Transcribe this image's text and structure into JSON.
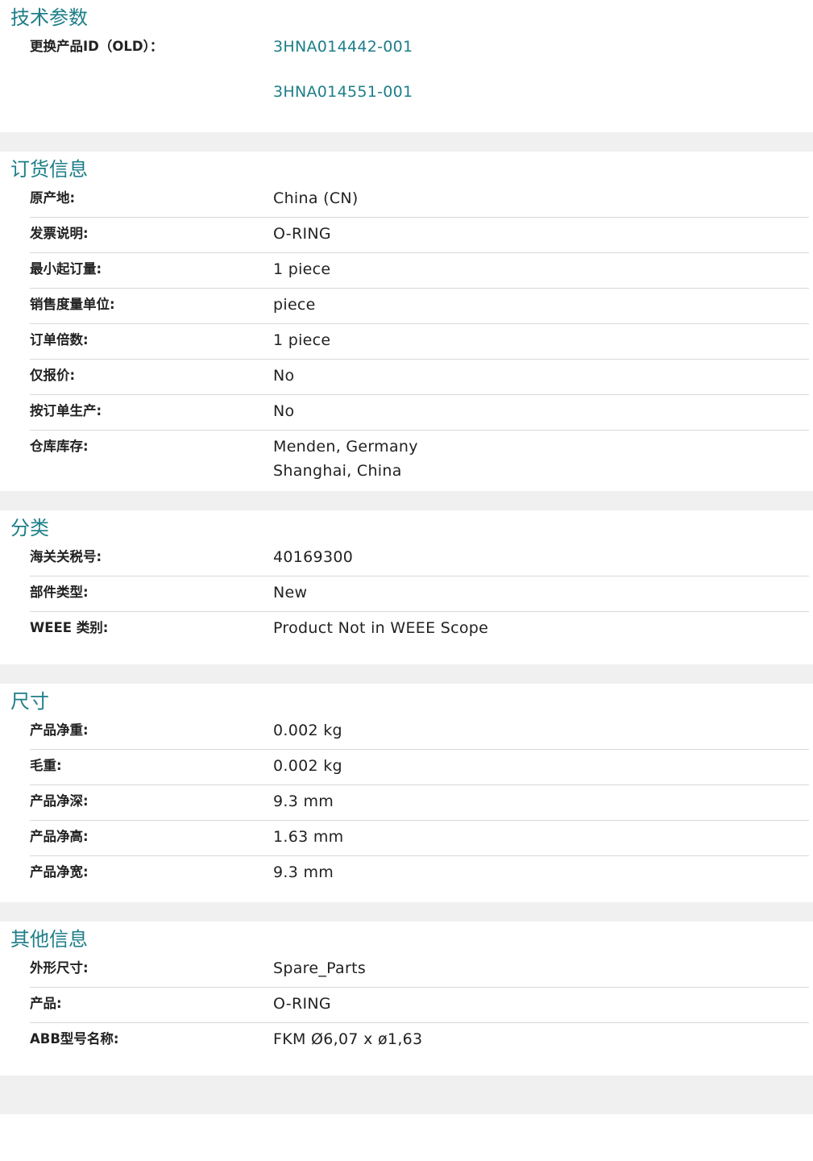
{
  "tech": {
    "title": "技术参数",
    "label": "更换产品ID（OLD）：",
    "links": [
      "3HNA014442-001",
      "3HNA014551-001"
    ]
  },
  "order": {
    "title": "订货信息",
    "rows": [
      {
        "label": "原产地:",
        "values": [
          "China (CN)"
        ]
      },
      {
        "label": "发票说明:",
        "values": [
          "O-RING"
        ]
      },
      {
        "label": "最小起订量:",
        "values": [
          "1 piece"
        ]
      },
      {
        "label": "销售度量单位:",
        "values": [
          "piece"
        ]
      },
      {
        "label": "订单倍数:",
        "values": [
          "1 piece"
        ]
      },
      {
        "label": "仅报价:",
        "values": [
          "No"
        ]
      },
      {
        "label": "按订单生产:",
        "values": [
          "No"
        ]
      },
      {
        "label": "仓库库存:",
        "values": [
          "Menden, Germany",
          "Shanghai, China"
        ]
      }
    ]
  },
  "classification": {
    "title": "分类",
    "rows": [
      {
        "label": "海关关税号:",
        "values": [
          "40169300"
        ]
      },
      {
        "label": "部件类型:",
        "values": [
          "New"
        ]
      },
      {
        "label": "WEEE 类别:",
        "values": [
          "Product Not in WEEE Scope"
        ]
      }
    ]
  },
  "dimensions": {
    "title": "尺寸",
    "rows": [
      {
        "label": "产品净重:",
        "values": [
          "0.002 kg"
        ]
      },
      {
        "label": "毛重:",
        "values": [
          "0.002 kg"
        ]
      },
      {
        "label": "产品净深:",
        "values": [
          "9.3 mm"
        ]
      },
      {
        "label": "产品净高:",
        "values": [
          "1.63 mm"
        ]
      },
      {
        "label": "产品净宽:",
        "values": [
          "9.3 mm"
        ]
      }
    ]
  },
  "other": {
    "title": "其他信息",
    "rows": [
      {
        "label": "外形尺寸:",
        "values": [
          "Spare_Parts"
        ]
      },
      {
        "label": "产品:",
        "values": [
          "O-RING"
        ]
      },
      {
        "label": "ABB型号名称:",
        "values": [
          "FKM Ø6,07 x ø1,63"
        ]
      }
    ]
  },
  "colors": {
    "accent": "#1d7e88",
    "text": "#222222",
    "divider": "#d8d8d8",
    "gap": "#f0f0f0"
  }
}
